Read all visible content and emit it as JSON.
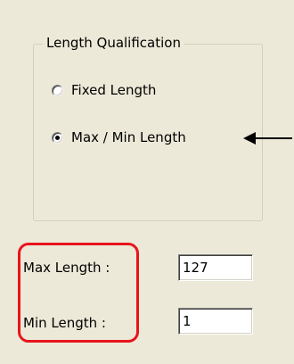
{
  "group": {
    "title": "Length Qualification",
    "options": [
      {
        "label": "Fixed Length",
        "selected": false
      },
      {
        "label": "Max / Min Length",
        "selected": true
      }
    ]
  },
  "fields": {
    "max_length": {
      "label": "Max Length :",
      "value": "127"
    },
    "min_length": {
      "label": "Min Length :",
      "value": "1"
    }
  },
  "annotations": {
    "highlight_color": "#E8141C",
    "arrow_color": "#000000",
    "arrow_target": "Max / Min Length"
  },
  "colors": {
    "dialog_background": "#ECE9D8",
    "groupbox_border": "#D0D0BF"
  }
}
